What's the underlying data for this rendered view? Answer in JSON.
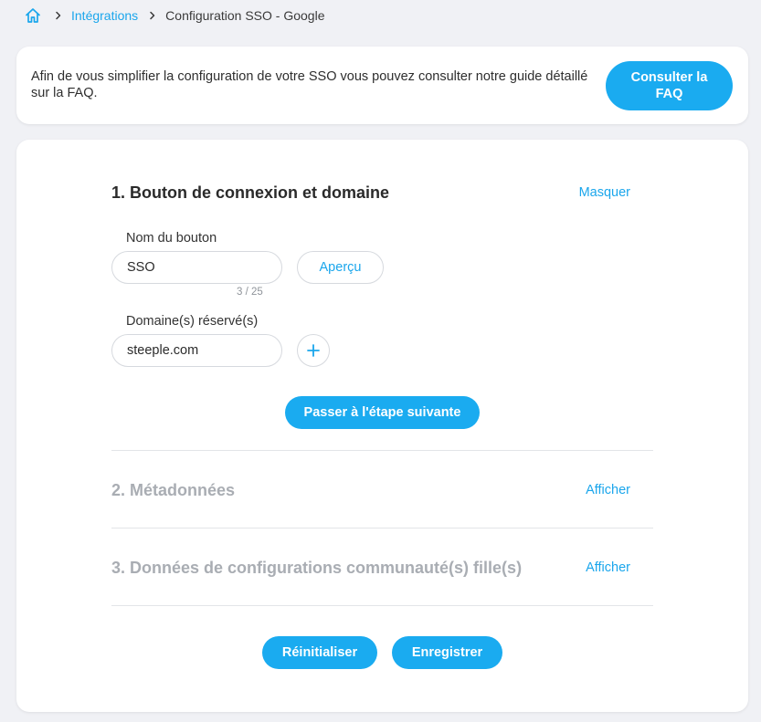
{
  "breadcrumb": {
    "home_icon": "home-icon",
    "link": "Intégrations",
    "current": "Configuration SSO - Google"
  },
  "info": {
    "text": "Afin de vous simplifier la configuration de votre SSO vous pouvez consulter notre guide détaillé sur la FAQ.",
    "button": "Consulter la FAQ"
  },
  "section1": {
    "title": "1. Bouton de connexion et domaine",
    "toggle": "Masquer",
    "button_name_label": "Nom du bouton",
    "button_name_value": "SSO",
    "counter": "3 / 25",
    "preview_button": "Aperçu",
    "domains_label": "Domaine(s) réservé(s)",
    "domain_value": "steeple.com",
    "add_icon": "plus-icon",
    "next_button": "Passer à l'étape suivante"
  },
  "section2": {
    "title": "2. Métadonnées",
    "toggle": "Afficher"
  },
  "section3": {
    "title": "3. Données de configurations communauté(s) fille(s)",
    "toggle": "Afficher"
  },
  "actions": {
    "reset": "Réinitialiser",
    "save": "Enregistrer"
  },
  "colors": {
    "accent": "#1aabf0",
    "background": "#f0f1f5",
    "muted_title": "#a9adb3"
  }
}
